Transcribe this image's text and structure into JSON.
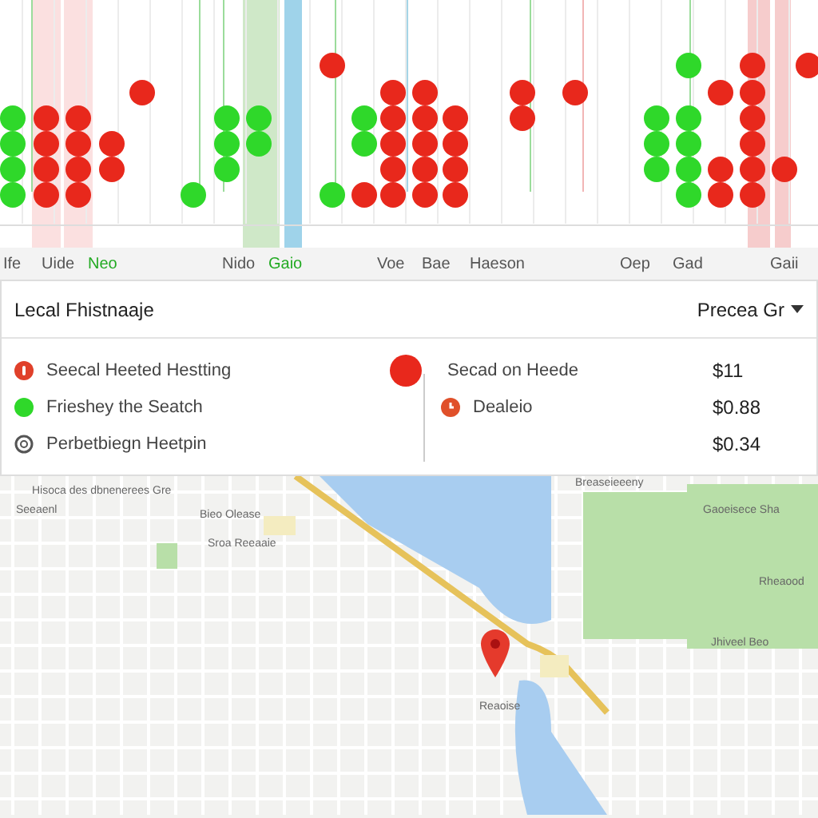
{
  "chart": {
    "labels": [
      {
        "text": "Ife",
        "color": "#555555"
      },
      {
        "text": "Uide",
        "color": "#555555"
      },
      {
        "text": "Neo",
        "color": "#22aa22"
      },
      {
        "text": "Nido",
        "color": "#555555"
      },
      {
        "text": "Gaio",
        "color": "#22aa22"
      },
      {
        "text": "Voe",
        "color": "#555555"
      },
      {
        "text": "Bae",
        "color": "#555555"
      },
      {
        "text": "Haeson",
        "color": "#555555"
      },
      {
        "text": "Oep",
        "color": "#555555"
      },
      {
        "text": "Gad",
        "color": "#555555"
      },
      {
        "text": "Gaii",
        "color": "#555555"
      }
    ]
  },
  "panel": {
    "title": "Lecal Fhistnaaje",
    "dropdown": "Precea Gr",
    "items": [
      {
        "kind": "alert",
        "label": "Seecal Heeted Hestting"
      },
      {
        "kind": "ok",
        "label": "Frieshey the Seatch"
      },
      {
        "kind": "search",
        "label": "Perbetbiegn Heetpin"
      }
    ],
    "timeline": [
      {
        "kind": "pin",
        "label": "Secad on Heede",
        "price": "$11"
      },
      {
        "kind": "clock",
        "label": "Dealeio",
        "price": "$0.88"
      },
      {
        "kind": "none",
        "price": "$0.34"
      }
    ]
  },
  "map": {
    "labels": [
      "Hisoca des dbnenerees Gre",
      "Bieo Olease",
      "Sroa Reeaaie",
      "Breaseieeeny",
      "Gaoeisece Sha",
      "Rheaood",
      "Jhiveel Beo",
      "Reaoise",
      "Seeaenl"
    ]
  }
}
